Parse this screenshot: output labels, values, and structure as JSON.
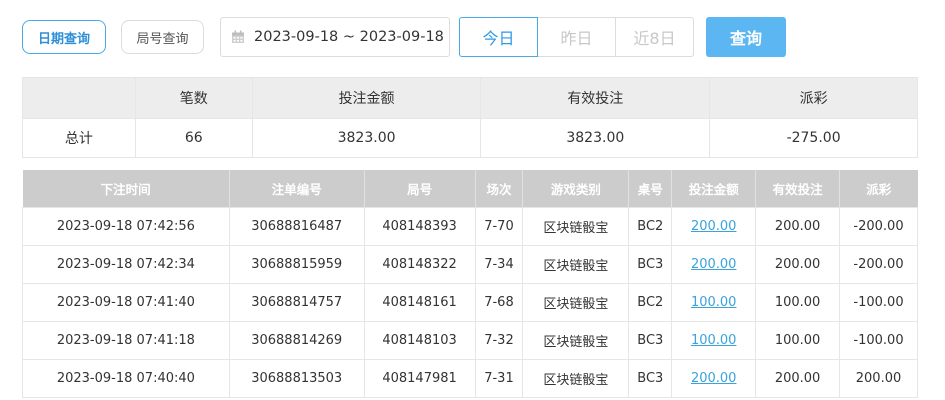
{
  "filters": {
    "tab_date": "日期查询",
    "tab_round": "局号查询",
    "date_range": "2023-09-18 ~ 2023-09-18",
    "quick": [
      "今日",
      "昨日",
      "近8日"
    ],
    "query": "查询"
  },
  "summary": {
    "headers": [
      "",
      "笔数",
      "投注金额",
      "有效投注",
      "派彩"
    ],
    "row": {
      "label": "总计",
      "count": "66",
      "bet": "3823.00",
      "valid": "3823.00",
      "payout": "-275.00"
    }
  },
  "detail": {
    "headers": [
      "下注时间",
      "注单编号",
      "局号",
      "场次",
      "游戏类别",
      "桌号",
      "投注金额",
      "有效投注",
      "派彩"
    ],
    "rows": [
      {
        "time": "2023-09-18 07:42:56",
        "order": "30688816487",
        "round": "408148393",
        "session": "7-70",
        "game": "区块链骰宝",
        "table": "BC2",
        "bet": "200.00",
        "valid": "200.00",
        "payout": "-200.00"
      },
      {
        "time": "2023-09-18 07:42:34",
        "order": "30688815959",
        "round": "408148322",
        "session": "7-34",
        "game": "区块链骰宝",
        "table": "BC3",
        "bet": "200.00",
        "valid": "200.00",
        "payout": "-200.00"
      },
      {
        "time": "2023-09-18 07:41:40",
        "order": "30688814757",
        "round": "408148161",
        "session": "7-68",
        "game": "区块链骰宝",
        "table": "BC2",
        "bet": "100.00",
        "valid": "100.00",
        "payout": "-100.00"
      },
      {
        "time": "2023-09-18 07:41:18",
        "order": "30688814269",
        "round": "408148103",
        "session": "7-32",
        "game": "区块链骰宝",
        "table": "BC3",
        "bet": "100.00",
        "valid": "100.00",
        "payout": "-100.00"
      },
      {
        "time": "2023-09-18 07:40:40",
        "order": "30688813503",
        "round": "408147981",
        "session": "7-31",
        "game": "区块链骰宝",
        "table": "BC3",
        "bet": "200.00",
        "valid": "200.00",
        "payout": "200.00"
      }
    ]
  },
  "colors": {
    "accent": "#4aa8e8",
    "query_button": "#5bb6f2",
    "negative": "#e8453c",
    "header_gray": "#cccccc"
  }
}
